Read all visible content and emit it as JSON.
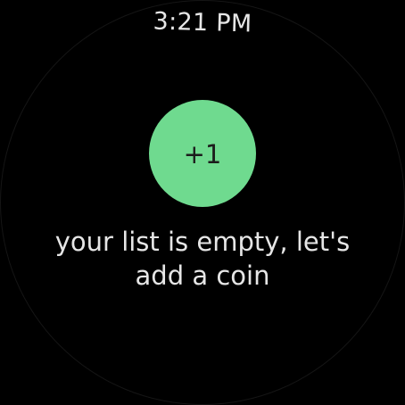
{
  "status": {
    "time": "3:21 PM"
  },
  "main": {
    "add_button_label": "+1",
    "empty_message": "your list is empty, let's add a coin"
  },
  "colors": {
    "background": "#000000",
    "accent": "#6fda8f",
    "text": "#e6e6e6",
    "button_text": "#1c1c1c"
  }
}
